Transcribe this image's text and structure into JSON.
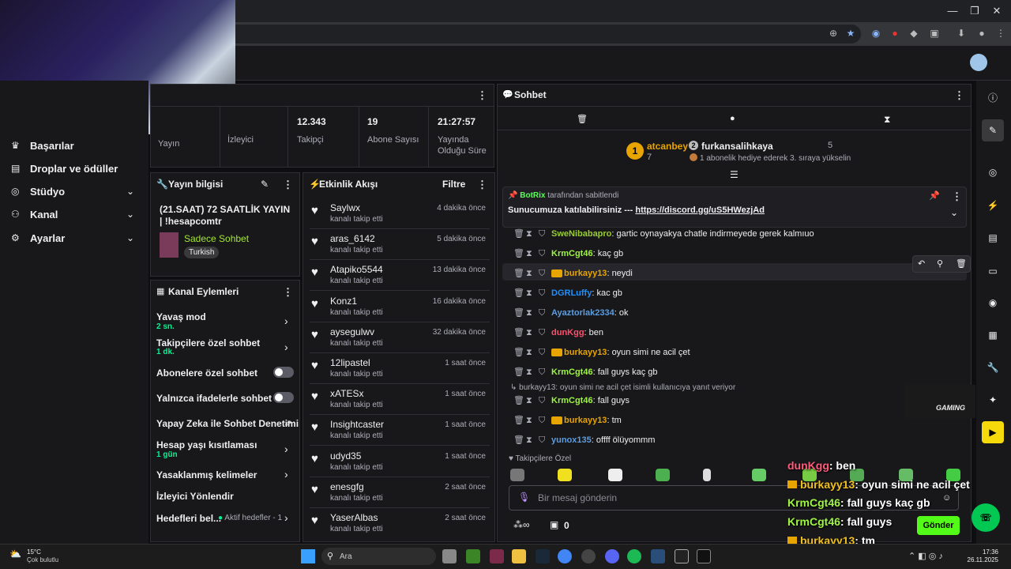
{
  "browser": {
    "window_controls": [
      "—",
      "❐",
      "✕"
    ]
  },
  "nav": {
    "items": [
      {
        "label": "Başarılar",
        "icon": "trophy-icon"
      },
      {
        "label": "Droplar ve ödüller",
        "icon": "gift-icon"
      },
      {
        "label": "Stüdyo",
        "icon": "studio-icon"
      },
      {
        "label": "Kanal",
        "icon": "channel-icon"
      },
      {
        "label": "Ayarlar",
        "icon": "gear-icon"
      }
    ]
  },
  "stats": [
    {
      "value": "",
      "label": "Yayın"
    },
    {
      "value": "",
      "label": "İzleyici"
    },
    {
      "value": "12.343",
      "label": "Takipçi"
    },
    {
      "value": "19",
      "label": "Abone Sayısı"
    },
    {
      "value": "21:27:57",
      "label": "Yayında Olduğu Süre"
    }
  ],
  "stream_info": {
    "title": "Yayın bilgisi",
    "stream_title": "(21.SAAT) 72 SAATLİK YAYIN | !hesapcomtr",
    "category": "Sadece Sohbet",
    "tag": "Turkish"
  },
  "actions": {
    "title": "Kanal Eylemleri",
    "items": [
      {
        "label": "Yavaş mod",
        "sub": "2 sn."
      },
      {
        "label": "Takipçilere özel sohbet",
        "sub": "1 dk."
      },
      {
        "label": "Abonelere özel sohbet",
        "sub": ""
      },
      {
        "label": "Yalnızca ifadelerle sohbet",
        "sub": ""
      },
      {
        "label": "Yapay Zeka ile Sohbet Denetimi",
        "sub": ""
      },
      {
        "label": "Hesap yaşı kısıtlaması",
        "sub": "1 gün"
      },
      {
        "label": "Yasaklanmış kelimeler",
        "sub": ""
      },
      {
        "label": "İzleyici Yönlendir",
        "sub": ""
      },
      {
        "label": "Hedefleri bel...",
        "sub": ""
      }
    ],
    "goal_status": "Aktif hedefler - 1"
  },
  "activity": {
    "title": "Etkinlik Akışı",
    "filter": "Filtre",
    "events": [
      {
        "name": "Saylwx",
        "sub": "kanalı takip etti",
        "time": "4 dakika önce"
      },
      {
        "name": "aras_6142",
        "sub": "kanalı takip etti",
        "time": "5 dakika önce"
      },
      {
        "name": "Atapiko5544",
        "sub": "kanalı takip etti",
        "time": "13 dakika önce"
      },
      {
        "name": "Konz1",
        "sub": "kanalı takip etti",
        "time": "16 dakika önce"
      },
      {
        "name": "aysegulwv",
        "sub": "kanalı takip etti",
        "time": "32 dakika önce"
      },
      {
        "name": "12lipastel",
        "sub": "kanalı takip etti",
        "time": "1 saat önce"
      },
      {
        "name": "xATESx",
        "sub": "kanalı takip etti",
        "time": "1 saat önce"
      },
      {
        "name": "Insightcaster",
        "sub": "kanalı takip etti",
        "time": "1 saat önce"
      },
      {
        "name": "udyd35",
        "sub": "kanalı takip etti",
        "time": "1 saat önce"
      },
      {
        "name": "enesgfg",
        "sub": "kanalı takip etti",
        "time": "2 saat önce"
      },
      {
        "name": "YaserAlbas",
        "sub": "kanalı takip etti",
        "time": "2 saat önce"
      }
    ]
  },
  "chat": {
    "title": "Sohbet",
    "leader1": {
      "rank": "1",
      "name": "atcanbey",
      "count": "7"
    },
    "leader2": {
      "rank": "2",
      "name": "furkansalihkaya",
      "count": "5"
    },
    "leader_note": "1 abonelik hediye ederek 3. sıraya yükselin",
    "pinned": {
      "by": "BotRix",
      "by_suffix": "tarafından sabitlendi",
      "text": "Sunucumuza katılabilirsiniz --- ",
      "link": "https://discord.gg/uS5HWezjAd"
    },
    "messages": [
      {
        "user": "SweNibabapro",
        "color": "#9acd32",
        "crown": false,
        "text": "gartic oynayakya chatle indirmeyede gerek kalmıuo"
      },
      {
        "user": "KrmCgt46",
        "color": "#9ef542",
        "crown": false,
        "text": "kaç gb"
      },
      {
        "user": "burkayy13",
        "color": "#e8a400",
        "crown": true,
        "text": "neydi"
      },
      {
        "user": "DGRLuffy",
        "color": "#1e90ff",
        "crown": false,
        "text": "kac gb"
      },
      {
        "user": "Ayaztorlak2334",
        "color": "#5c9de0",
        "crown": false,
        "text": "ok"
      },
      {
        "user": "dunKgg",
        "color": "#ff4f6d",
        "crown": false,
        "text": "ben"
      },
      {
        "user": "burkayy13",
        "color": "#e8a400",
        "crown": true,
        "text": "oyun simi ne acil çet"
      },
      {
        "user": "KrmCgt46",
        "color": "#9ef542",
        "crown": false,
        "text": "fall guys kaç gb"
      },
      {
        "user": "KrmCgt46",
        "color": "#9ef542",
        "crown": false,
        "text": "fall guys"
      },
      {
        "user": "burkayy13",
        "color": "#e8a400",
        "crown": true,
        "text": "tm"
      },
      {
        "user": "yunox135",
        "color": "#5c9de0",
        "crown": false,
        "text": "offff ölüyommm"
      }
    ],
    "reply_note": "burkayy13: oyun simi ne acil çet isimli kullanıcıya yanıt veriyor",
    "followers_only": "Takipçilere Özel",
    "input_placeholder": "Bir mesaj gönderin",
    "send": "Gönder",
    "points": "0"
  },
  "overlay": [
    {
      "user": "dunKgg",
      "color": "#ff5a7a",
      "text": ": ben",
      "crown": false
    },
    {
      "user": "burkayy13",
      "color": "#f0c020",
      "text": ": oyun simi ne acil çet",
      "crown": true
    },
    {
      "user": "KrmCgt46",
      "color": "#9ef542",
      "text": ": fall guys kaç gb",
      "crown": false
    },
    {
      "user": "KrmCgt46",
      "color": "#9ef542",
      "text": ": fall guys",
      "crown": false
    },
    {
      "user": "burkayy13",
      "color": "#f0c020",
      "text": ": tm",
      "crown": true
    },
    {
      "user": "yunox135",
      "color": "#87ceeb",
      "text": ": offff ölüyommm",
      "crown": false
    }
  ],
  "taskbar": {
    "weather_temp": "15°C",
    "weather_desc": "Çok bulutlu",
    "search": "Ara",
    "time": "17:36",
    "date": "26.11.2025"
  },
  "logo_text": "GAMING"
}
